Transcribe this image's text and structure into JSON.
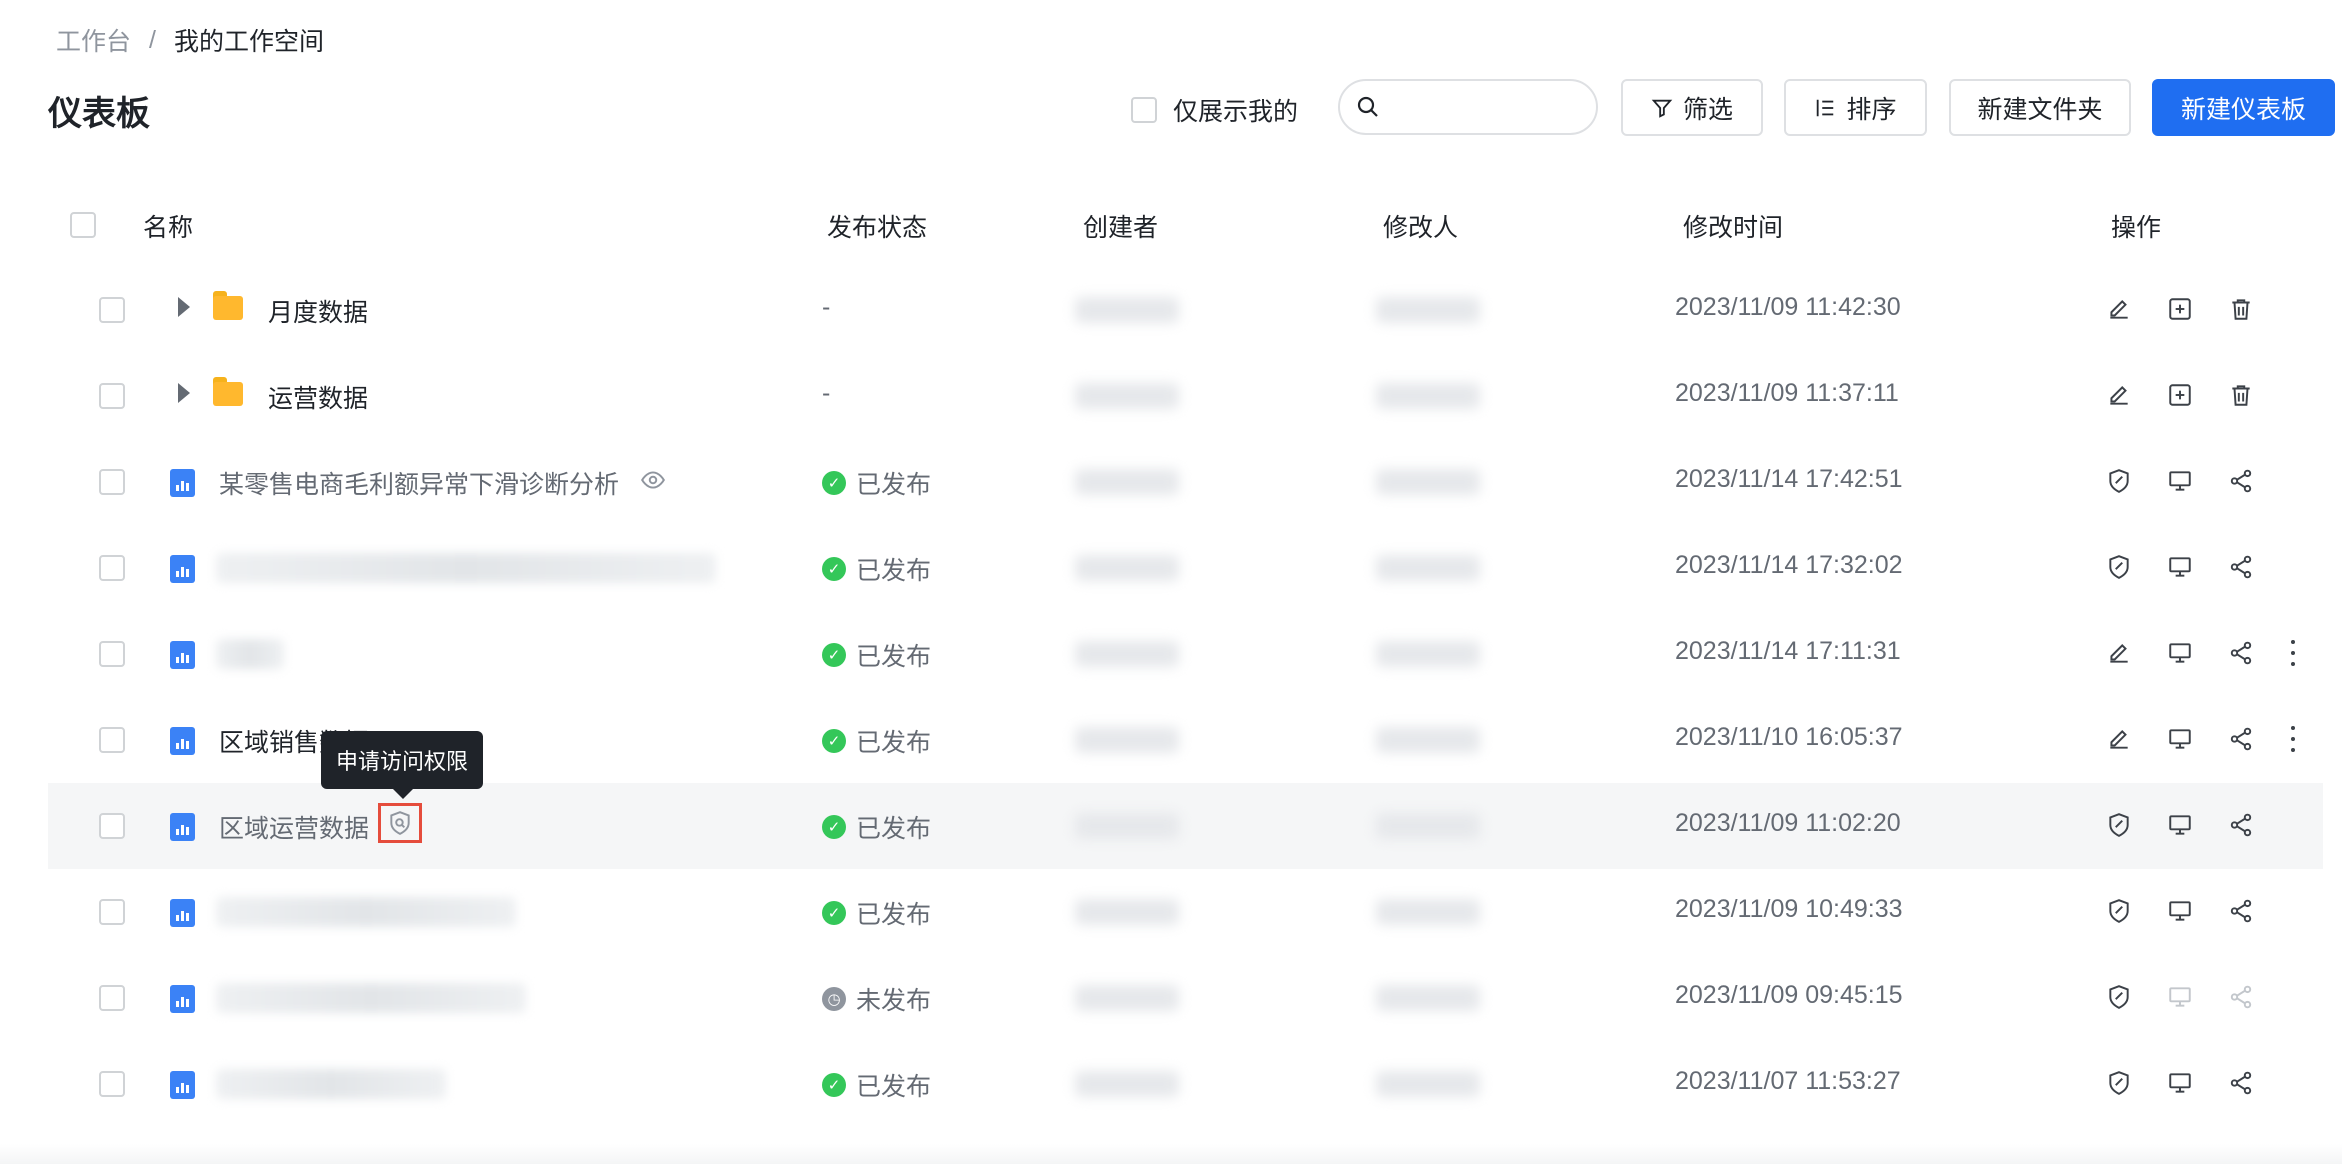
{
  "breadcrumb": {
    "root": "工作台",
    "separator": "/",
    "current": "我的工作空间"
  },
  "page_title": "仪表板",
  "toolbar": {
    "only_mine": "仅展示我的",
    "search_placeholder": "",
    "filter": "筛选",
    "sort": "排序",
    "new_folder": "新建文件夹",
    "new_dashboard": "新建仪表板"
  },
  "table": {
    "headers": {
      "name": "名称",
      "status": "发布状态",
      "creator": "创建者",
      "modifier": "修改人",
      "mtime": "修改时间",
      "ops": "操作"
    },
    "rows": [
      {
        "type": "folder",
        "name": "月度数据",
        "status": "-",
        "mtime": "2023/11/09 11:42:30",
        "ops": [
          "edit",
          "add",
          "delete"
        ]
      },
      {
        "type": "folder",
        "name": "运营数据",
        "status": "-",
        "mtime": "2023/11/09 11:37:11",
        "ops": [
          "edit",
          "add",
          "delete"
        ]
      },
      {
        "type": "dashboard",
        "name": "某零售电商毛利额异常下滑诊断分析",
        "status": "已发布",
        "mtime": "2023/11/14 17:42:51",
        "ops": [
          "shield",
          "present",
          "share"
        ]
      },
      {
        "type": "dashboard",
        "name": "",
        "status": "已发布",
        "mtime": "2023/11/14 17:32:02",
        "ops": [
          "shield",
          "present",
          "share"
        ]
      },
      {
        "type": "dashboard",
        "name": "",
        "status": "已发布",
        "mtime": "2023/11/14 17:11:31",
        "ops": [
          "edit",
          "present",
          "share"
        ]
      },
      {
        "type": "dashboard",
        "name": "区域销售数据",
        "status": "已发布",
        "mtime": "2023/11/10 16:05:37",
        "ops": [
          "edit",
          "present",
          "share"
        ]
      },
      {
        "type": "dashboard",
        "name": "区域运营数据",
        "status": "已发布",
        "mtime": "2023/11/09 11:02:20",
        "ops": [
          "shield",
          "present",
          "share"
        ]
      },
      {
        "type": "dashboard",
        "name": "",
        "status": "已发布",
        "mtime": "2023/11/09 10:49:33",
        "ops": [
          "shield",
          "present",
          "share"
        ]
      },
      {
        "type": "dashboard",
        "name": "",
        "status": "未发布",
        "mtime": "2023/11/09 09:45:15",
        "ops": [
          "shield",
          "present",
          "share"
        ]
      },
      {
        "type": "dashboard",
        "name": "",
        "status": "已发布",
        "mtime": "2023/11/07 11:53:27",
        "ops": [
          "shield",
          "present",
          "share"
        ]
      }
    ]
  },
  "tooltip": "申请访问权限",
  "colors": {
    "primary": "#1f6ef1",
    "published": "#34c759",
    "unpublished": "#8f959e",
    "highlight": "#e54c3c",
    "folder": "#ffb82e",
    "dashboard_icon": "#3b82f6"
  }
}
